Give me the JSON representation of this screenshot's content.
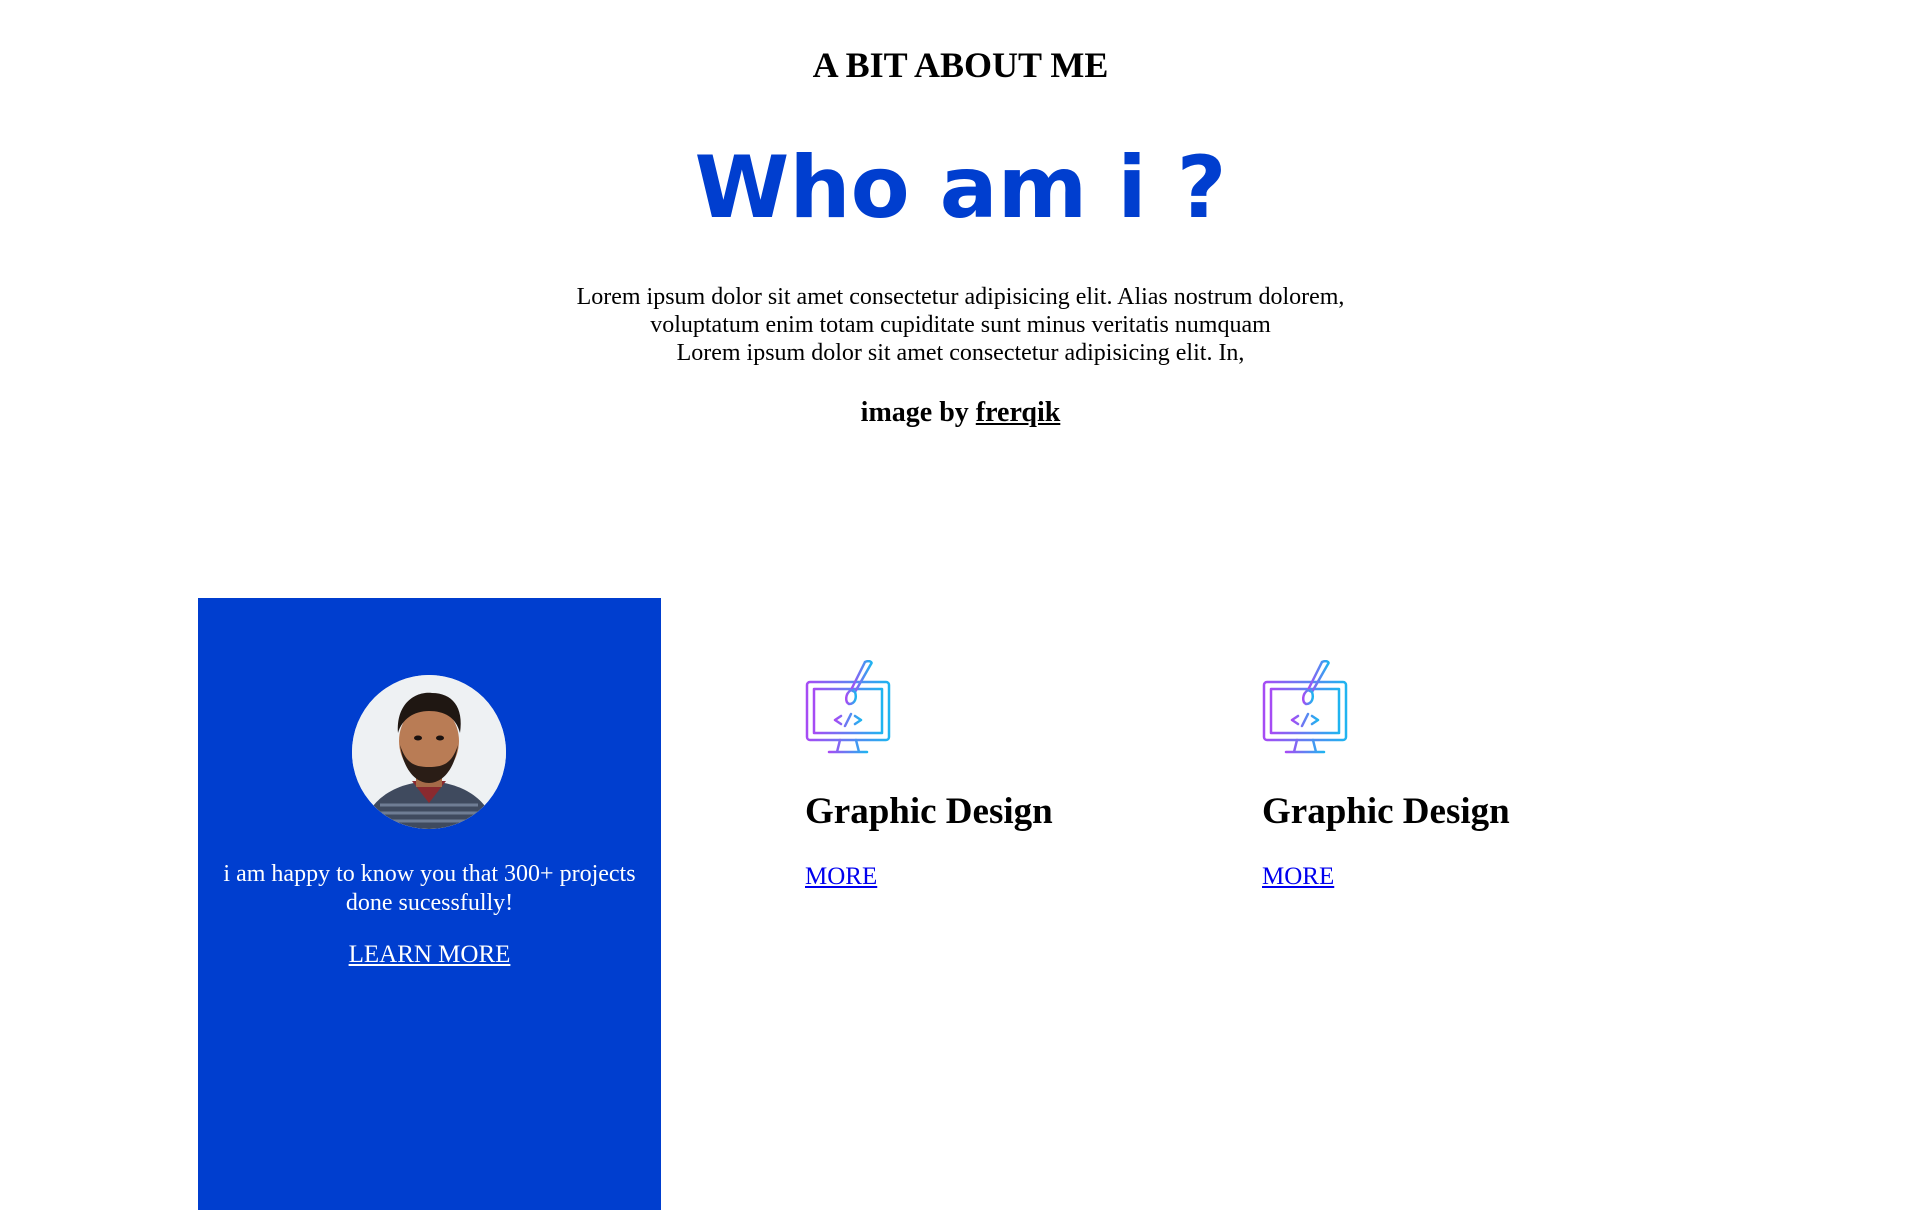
{
  "about": {
    "eyebrow": "A BIT ABOUT ME",
    "headline": "Who am i ?",
    "intro_lines": [
      "Lorem ipsum dolor sit amet consectetur adipisicing elit. Alias nostrum dolorem,",
      "voluptatum enim totam cupiditate sunt minus veritatis numquam",
      "Lorem ipsum dolor sit amet consectetur adipisicing elit. In,"
    ],
    "credit_prefix": "image by",
    "credit_link": "frerqik"
  },
  "profile_card": {
    "text": "i am happy to know you that 300+ projects done sucessfully!",
    "link": "LEARN MORE",
    "background": "#003ecf"
  },
  "services": [
    {
      "icon": "graphic-design-monitor-brush-icon",
      "title": "Graphic Design",
      "link": "MORE"
    },
    {
      "icon": "graphic-design-monitor-brush-icon",
      "title": "Graphic Design",
      "link": "MORE"
    }
  ],
  "colors": {
    "accent": "#003ecf",
    "link": "#0000ee",
    "icon_gradient_start": "#a64bf4",
    "icon_gradient_end": "#1fb4f0"
  }
}
